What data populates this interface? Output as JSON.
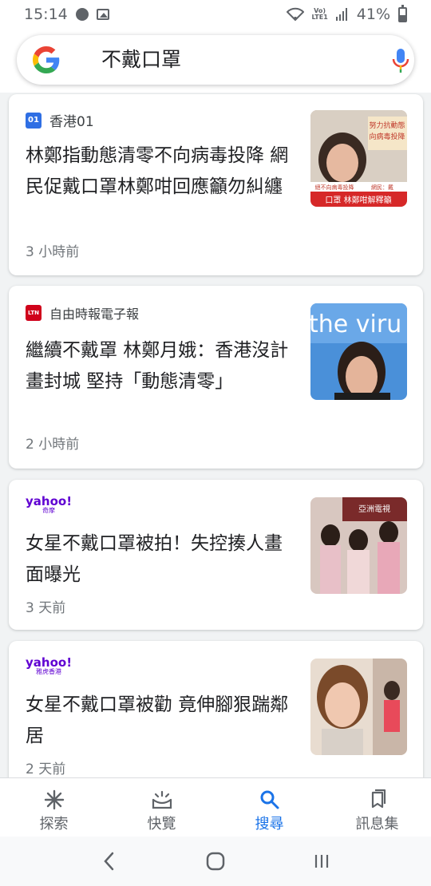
{
  "status_bar": {
    "time": "15:14",
    "volte_line1": "Vo)",
    "volte_line2": "LTE1",
    "battery": "41%",
    "battery_level": 0.41
  },
  "search": {
    "query": "不戴口罩",
    "brand_colors": {
      "blue": "#4285F4",
      "red": "#EA4335",
      "yellow": "#FBBC05",
      "green": "#34A853"
    }
  },
  "cards": [
    {
      "source": "香港01",
      "source_logo": "01",
      "source_logo_color": "#2f6fe4",
      "headline": "林鄭指動態清零不向病毒投降 網民促戴口罩林鄭咁回應籲勿糾纏",
      "time": "3 小時前",
      "thumb_texts": [
        "努力抗動態",
        "向病毒投降",
        "絕不向病毒投降",
        "網民：戴",
        "口罩 林鄭咁解釋籲"
      ]
    },
    {
      "source": "自由時報電子報",
      "source_logo": "LTN",
      "source_logo_color": "#d0021b",
      "headline": "繼續不戴罩 林鄭月娥：香港沒計畫封城 堅持「動態清零」",
      "time": "2 小時前",
      "thumb_texts": [
        "the viru"
      ]
    },
    {
      "source": "yahoo!",
      "source_sub": "奇摩",
      "source_logo_color": "#6001d2",
      "headline": "女星不戴口罩被拍！失控揍人畫面曝光",
      "time": "3 天前",
      "thumb_texts": [
        "亞洲電視"
      ]
    },
    {
      "source": "yahoo!",
      "source_sub": "雅虎香港",
      "source_logo_color": "#6001d2",
      "headline": "女星不戴口罩被勸 竟伸腳狠踹鄰居",
      "time": "2 天前",
      "thumb_texts": []
    }
  ],
  "bottom_nav": {
    "items": [
      {
        "label": "探索",
        "icon": "asterisk-icon",
        "active": false
      },
      {
        "label": "快覽",
        "icon": "snapshot-icon",
        "active": false
      },
      {
        "label": "搜尋",
        "icon": "search-icon",
        "active": true
      },
      {
        "label": "訊息集",
        "icon": "collections-icon",
        "active": false
      }
    ],
    "active_color": "#1a73e8",
    "inactive_color": "#5f6368"
  }
}
